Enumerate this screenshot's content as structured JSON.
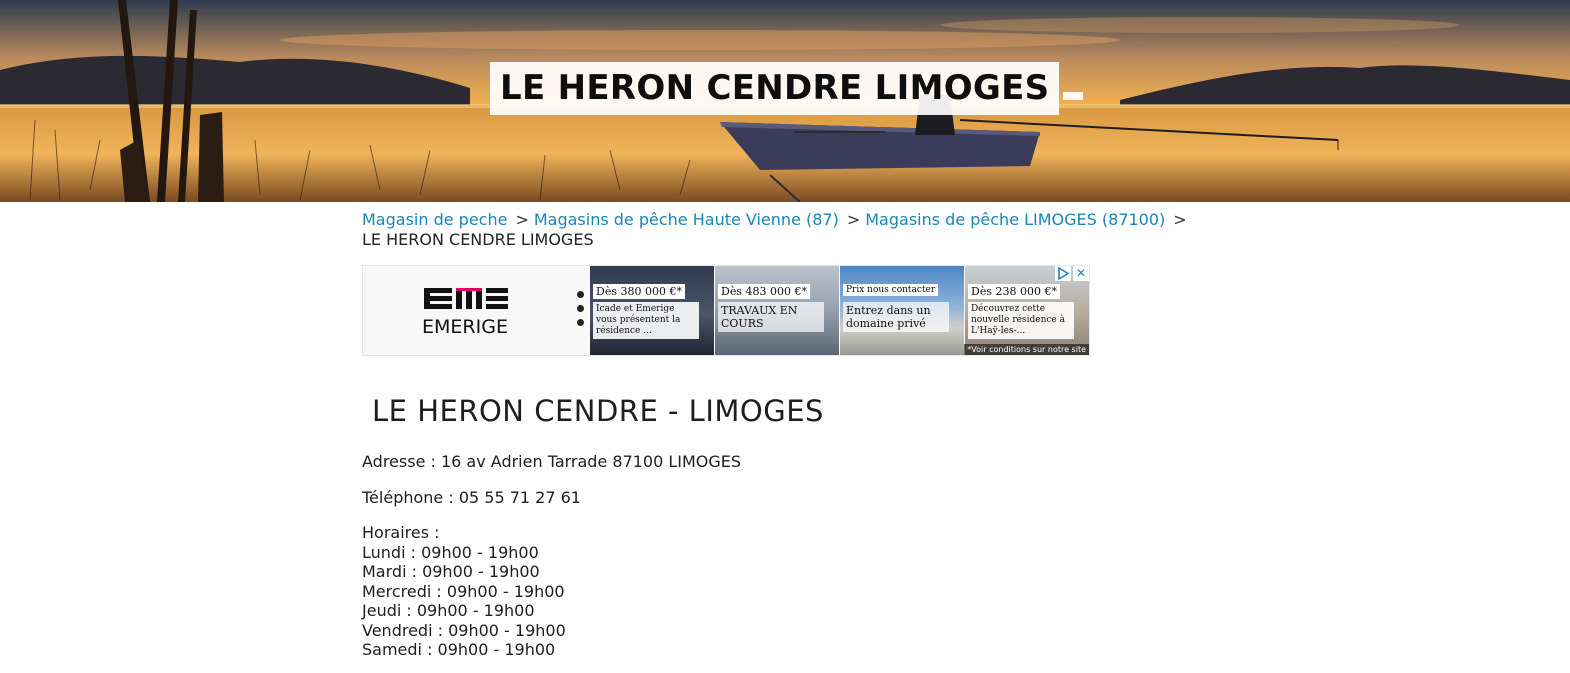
{
  "header": {
    "title": "LE HERON CENDRE LIMOGES"
  },
  "breadcrumb": {
    "items": [
      {
        "label": "Magasin de peche"
      },
      {
        "label": "Magasins de pêche Haute Vienne (87)"
      },
      {
        "label": "Magasins de pêche LIMOGES (87100)"
      }
    ],
    "separator": ">",
    "current": "LE HERON CENDRE LIMOGES"
  },
  "ad": {
    "brand": "EMERIGE",
    "cards": [
      {
        "price": "Dès 380 000 €*",
        "desc": "Icade et Emerige vous présentent la résidence ..."
      },
      {
        "price": "Dès 483 000 €*",
        "desc": "TRAVAUX EN COURS"
      },
      {
        "price": "Prix nous contacter",
        "desc": "Entrez dans un domaine privé"
      },
      {
        "price": "Dès 238 000 €*",
        "desc": "Découvrez cette nouvelle résidence à L'Haÿ-les-..."
      }
    ],
    "note": "*Voir conditions sur notre site",
    "close_label": "✕"
  },
  "store": {
    "name": "LE HERON CENDRE - LIMOGES",
    "address": "Adresse : 16 av Adrien Tarrade 87100 LIMOGES",
    "phone": "Téléphone : 05 55 71 27 61",
    "hours_title": "Horaires :",
    "hours": [
      "Lundi : 09h00 - 19h00",
      "Mardi : 09h00 - 19h00",
      "Mercredi : 09h00 - 19h00",
      "Jeudi : 09h00 - 19h00",
      "Vendredi : 09h00 - 19h00",
      "Samedi : 09h00 - 19h00"
    ]
  },
  "colors": {
    "link": "#1a86b8",
    "text": "#1e1e1e"
  }
}
